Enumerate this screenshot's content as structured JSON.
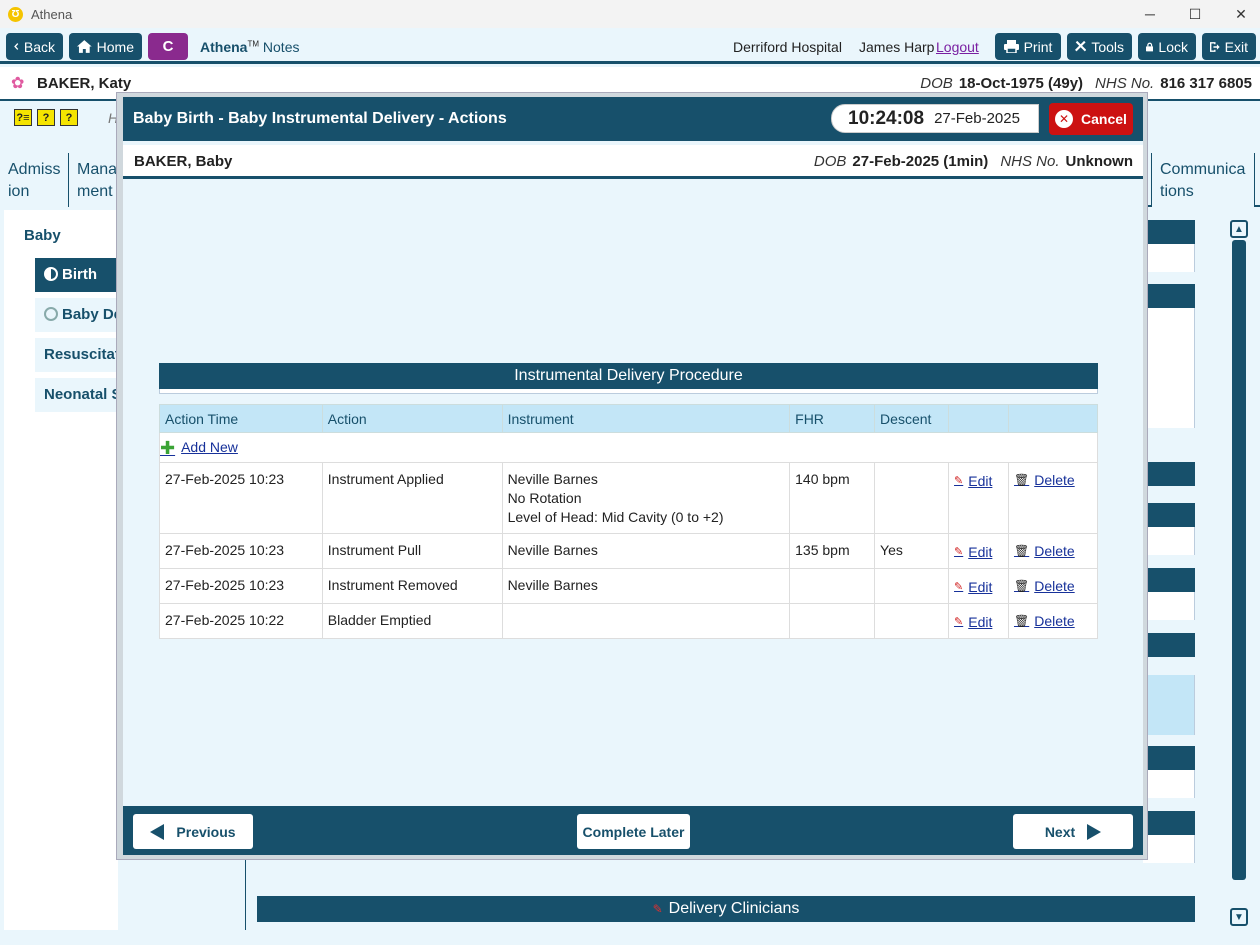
{
  "window": {
    "title": "Athena",
    "app_icon_letter": "Ʊ",
    "minimize": "─",
    "maximize": "☐",
    "close": "✕"
  },
  "toolbar": {
    "back": "Back",
    "home": "Home",
    "c_button": "C",
    "brand_name": "Athena",
    "brand_tm": "TM",
    "brand_suffix": "Notes",
    "hospital": "Derriford Hospital",
    "user": "James Harp",
    "logout": "Logout",
    "print": "Print",
    "tools": "Tools",
    "lock": "Lock",
    "exit": "Exit"
  },
  "patient": {
    "name": "BAKER, Katy",
    "dob_label": "DOB",
    "dob": "18-Oct-1975 (49y)",
    "nhs_label": "NHS No.",
    "nhs": "816 317 6805"
  },
  "background": {
    "help_icons": [
      "?≡",
      "?",
      "?"
    ],
    "h_text": "H",
    "tabs": [
      {
        "label": "Admiss ion"
      },
      {
        "label": "Mana ment"
      },
      {
        "label": "Communica tions"
      }
    ],
    "nav_section": "Baby",
    "nav_items": [
      {
        "label": "Birth",
        "active": true
      },
      {
        "label": "Baby Delivery",
        "active": false
      },
      {
        "label": "Resuscitation",
        "active": false
      },
      {
        "label": "Neonatal Screening",
        "active": false
      }
    ],
    "bottom_panel_title": "Delivery Clinicians"
  },
  "modal": {
    "title": "Baby Birth - Baby Instrumental Delivery - Actions",
    "time": "10:24:08",
    "date": "27-Feb-2025",
    "cancel": "Cancel",
    "baby_name": "BAKER, Baby",
    "baby_dob_label": "DOB",
    "baby_dob": "27-Feb-2025 (1min)",
    "baby_nhs_label": "NHS No.",
    "baby_nhs": "Unknown",
    "procedure_title": "Instrumental Delivery Procedure",
    "columns": [
      "Action Time",
      "Action",
      "Instrument",
      "FHR",
      "Descent",
      "",
      ""
    ],
    "add_new": "Add New",
    "edit_label": "Edit",
    "delete_label": "Delete",
    "rows": [
      {
        "time": "27-Feb-2025 10:23",
        "action": "Instrument Applied",
        "instrument": [
          "Neville Barnes",
          "No Rotation",
          "Level of Head: Mid Cavity (0 to +2)"
        ],
        "fhr": "140 bpm",
        "descent": ""
      },
      {
        "time": "27-Feb-2025 10:23",
        "action": "Instrument Pull",
        "instrument": [
          "Neville Barnes"
        ],
        "fhr": "135 bpm",
        "descent": "Yes"
      },
      {
        "time": "27-Feb-2025 10:23",
        "action": "Instrument Removed",
        "instrument": [
          "Neville Barnes"
        ],
        "fhr": "",
        "descent": ""
      },
      {
        "time": "27-Feb-2025 10:22",
        "action": "Bladder Emptied",
        "instrument": [
          ""
        ],
        "fhr": "",
        "descent": ""
      }
    ],
    "previous": "Previous",
    "complete_later": "Complete Later",
    "next": "Next"
  }
}
